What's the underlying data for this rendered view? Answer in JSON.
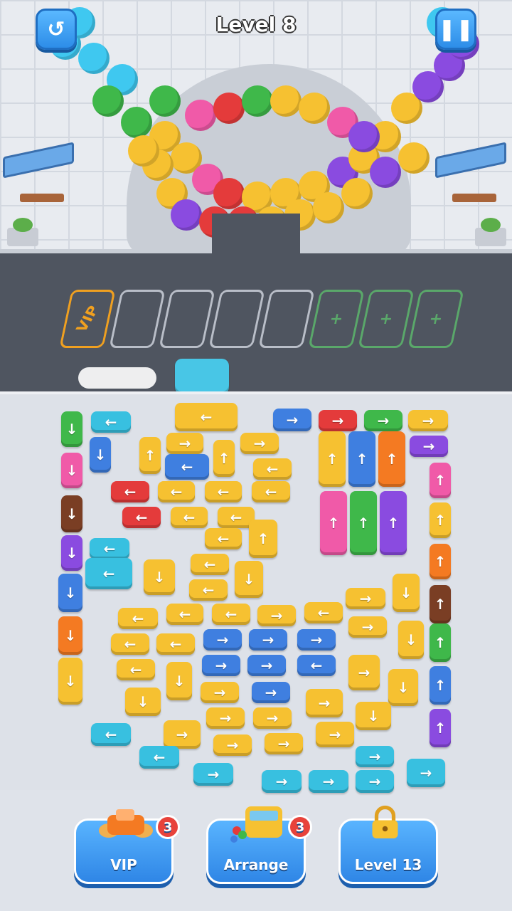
{
  "hud": {
    "title": "Level 8",
    "restart_icon": "restart-icon",
    "pause_icon": "pause-icon"
  },
  "parking": {
    "vip_label": "VIP",
    "plus_label": "+"
  },
  "buttons": {
    "vip": {
      "label": "VIP",
      "badge": "3"
    },
    "arrange": {
      "label": "Arrange",
      "badge": "3"
    },
    "locked": {
      "label": "Level 13"
    }
  },
  "colors": {
    "yellow": "#f6c131",
    "blue": "#3f7fe0",
    "cyan": "#38c0e0",
    "red": "#e43b3b",
    "green": "#3fb84a",
    "orange": "#f47a22",
    "pink": "#f05aa8",
    "purple": "#8a4be0",
    "brown": "#7a3e24"
  },
  "arrows": {
    "left": "←",
    "right": "→",
    "up": "↑",
    "down": "↓"
  }
}
